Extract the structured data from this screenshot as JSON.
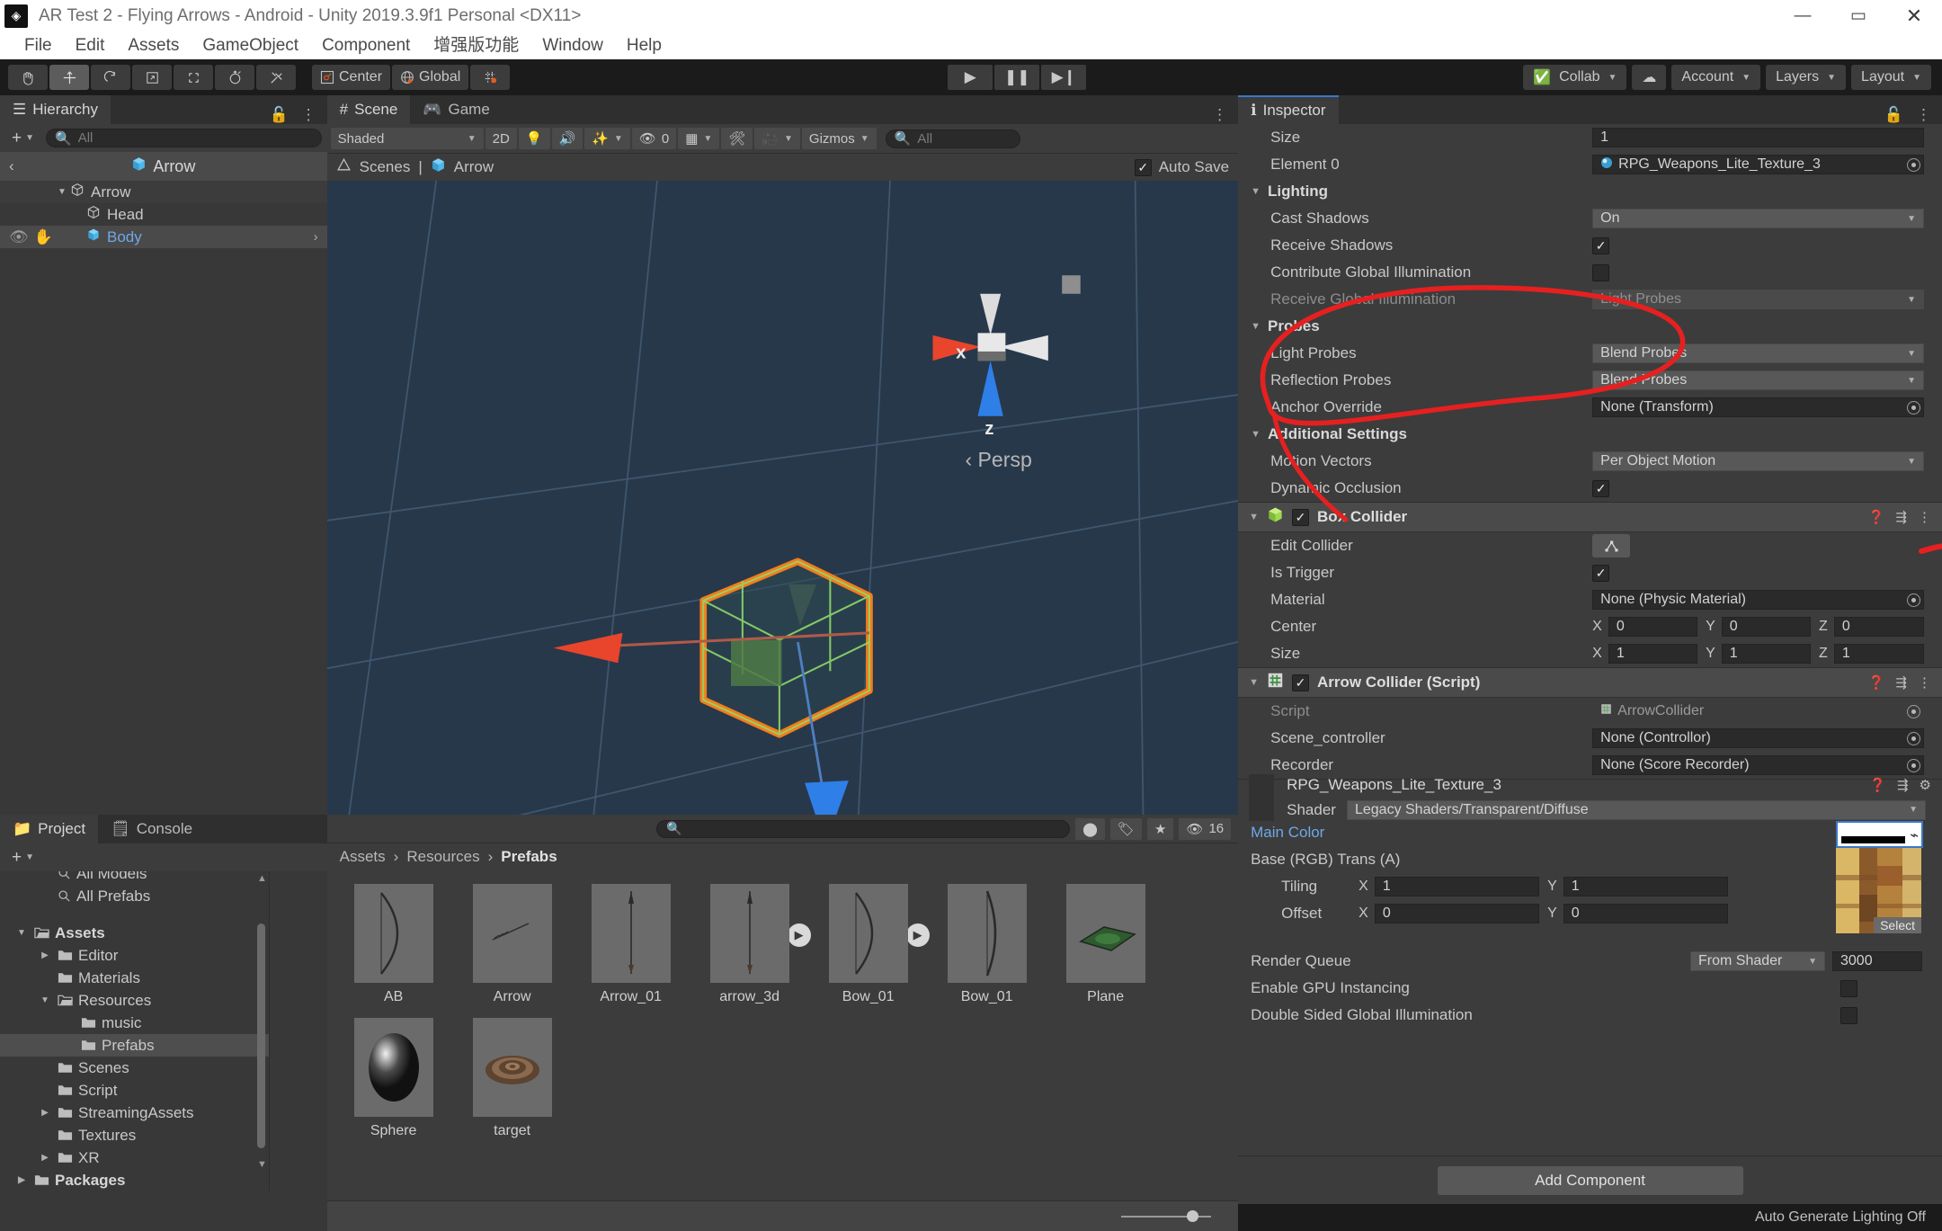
{
  "window": {
    "title": "AR Test 2 - Flying Arrows - Android - Unity 2019.3.9f1 Personal <DX11>",
    "minimize": "—",
    "maximize": "▭",
    "close": "✕"
  },
  "menubar": {
    "items": [
      "File",
      "Edit",
      "Assets",
      "GameObject",
      "Component",
      "增强版功能",
      "Window",
      "Help"
    ]
  },
  "toolbar": {
    "tools": [
      {
        "name": "hand-tool",
        "glyph": "✋"
      },
      {
        "name": "move-tool",
        "glyph": "✥"
      },
      {
        "name": "rotate-tool",
        "glyph": "⟳"
      },
      {
        "name": "scale-tool",
        "glyph": "⤢"
      },
      {
        "name": "rect-tool",
        "glyph": "▭"
      },
      {
        "name": "transform-tool",
        "glyph": "✣"
      },
      {
        "name": "custom-tool",
        "glyph": "✂"
      }
    ],
    "pivot_label": "Center",
    "space_label": "Global",
    "grid_label": "",
    "play": "▶",
    "pause": "❚❚",
    "step": "▶❙",
    "collab": "Collab",
    "cloud": "☁",
    "account": "Account",
    "layers": "Layers",
    "layout": "Layout"
  },
  "hierarchy": {
    "tab": "Hierarchy",
    "add_label": "+",
    "search_placeholder": "All",
    "breadcrumb": "Arrow",
    "back": "‹",
    "items": [
      {
        "label": "Arrow",
        "depth": 0,
        "expanded": true,
        "selected": false,
        "icon": "prefab-outline-icon"
      },
      {
        "label": "Head",
        "depth": 1,
        "expanded": false,
        "selected": false,
        "icon": "prefab-outline-icon"
      },
      {
        "label": "Body",
        "depth": 1,
        "expanded": false,
        "selected": true,
        "icon": "prefab-filled-icon"
      }
    ]
  },
  "scene": {
    "tabs": [
      {
        "label": "Scene",
        "icon": "scene-icon",
        "active": true
      },
      {
        "label": "Game",
        "icon": "game-icon",
        "active": false
      }
    ],
    "draw_mode": "Shaded",
    "mode_2d": "2D",
    "gizmos": "Gizmos",
    "gizmo_count": "0",
    "search_placeholder": "All",
    "breadcrumb_scene": "Scenes",
    "breadcrumb_prefab": "Arrow",
    "autosave_label": "Auto Save",
    "autosave_checked": true,
    "gizmo_axes": {
      "x": "x",
      "z": "z",
      "persp": "Persp"
    }
  },
  "inspector": {
    "tab": "Inspector",
    "materials_rows": [
      {
        "label": "Size",
        "value": "1",
        "type": "text"
      },
      {
        "label": "Element 0",
        "value": "RPG_Weapons_Lite_Texture_3",
        "type": "object"
      }
    ],
    "lighting": {
      "header": "Lighting",
      "rows": [
        {
          "label": "Cast Shadows",
          "value": "On",
          "type": "popup"
        },
        {
          "label": "Receive Shadows",
          "value": "",
          "type": "checkbox",
          "checked": true
        },
        {
          "label": "Contribute Global Illumination",
          "value": "",
          "type": "checkbox",
          "checked": false
        },
        {
          "label": "Receive Global Illumination",
          "value": "Light Probes",
          "type": "popup",
          "disabled": true
        }
      ]
    },
    "probes": {
      "header": "Probes",
      "rows": [
        {
          "label": "Light Probes",
          "value": "Blend Probes",
          "type": "popup"
        },
        {
          "label": "Reflection Probes",
          "value": "Blend Probes",
          "type": "popup"
        },
        {
          "label": "Anchor Override",
          "value": "None (Transform)",
          "type": "object"
        }
      ]
    },
    "additional": {
      "header": "Additional Settings",
      "rows": [
        {
          "label": "Motion Vectors",
          "value": "Per Object Motion",
          "type": "popup"
        },
        {
          "label": "Dynamic Occlusion",
          "value": "",
          "type": "checkbox",
          "checked": true
        }
      ]
    },
    "box_collider": {
      "title": "Box Collider",
      "enabled": true,
      "rows": [
        {
          "label": "Edit Collider",
          "type": "editbtn"
        },
        {
          "label": "Is Trigger",
          "type": "checkbox",
          "checked": true
        },
        {
          "label": "Material",
          "value": "None (Physic Material)",
          "type": "object"
        }
      ],
      "center": {
        "label": "Center",
        "x": "0",
        "y": "0",
        "z": "0"
      },
      "size": {
        "label": "Size",
        "x": "1",
        "y": "1",
        "z": "1"
      }
    },
    "arrow_collider": {
      "title": "Arrow Collider (Script)",
      "enabled": true,
      "rows": [
        {
          "label": "Script",
          "value": "ArrowCollider",
          "type": "script",
          "disabled": true
        },
        {
          "label": "Scene_controller",
          "value": "None (Controllor)",
          "type": "object"
        },
        {
          "label": "Recorder",
          "value": "None (Score Recorder)",
          "type": "object"
        }
      ]
    },
    "material": {
      "name": "RPG_Weapons_Lite_Texture_3",
      "shader_label": "Shader",
      "shader_value": "Legacy Shaders/Transparent/Diffuse",
      "main_color_label": "Main Color",
      "base_label": "Base (RGB) Trans (A)",
      "tiling": {
        "label": "Tiling",
        "x": "1",
        "y": "1"
      },
      "offset": {
        "label": "Offset",
        "x": "0",
        "y": "0"
      },
      "select_label": "Select",
      "render_queue_label": "Render Queue",
      "render_queue_mode": "From Shader",
      "render_queue_value": "3000",
      "gpu_instancing_label": "Enable GPU Instancing",
      "gpu_instancing_checked": false,
      "double_sided_label": "Double Sided Global Illumination",
      "double_sided_checked": false
    },
    "add_component": "Add Component"
  },
  "project": {
    "tabs": [
      {
        "label": "Project",
        "icon": "folder-icon",
        "active": true
      },
      {
        "label": "Console",
        "icon": "console-icon",
        "active": false
      }
    ],
    "add_label": "+",
    "search_placeholder": "",
    "asset_count": "16",
    "breadcrumb": [
      "Assets",
      "Resources",
      "Prefabs"
    ],
    "tree": [
      {
        "label": "All Models",
        "depth": 1,
        "icon": "search-icon",
        "tri": "",
        "clipped": true
      },
      {
        "label": "All Prefabs",
        "depth": 1,
        "icon": "search-icon",
        "tri": ""
      },
      {
        "label": "",
        "depth": 0,
        "icon": "",
        "tri": "",
        "spacer": true
      },
      {
        "label": "Assets",
        "depth": 0,
        "icon": "folder-open-icon",
        "tri": "▼",
        "bold": true
      },
      {
        "label": "Editor",
        "depth": 1,
        "icon": "folder-icon",
        "tri": "▶"
      },
      {
        "label": "Materials",
        "depth": 1,
        "icon": "folder-icon",
        "tri": ""
      },
      {
        "label": "Resources",
        "depth": 1,
        "icon": "folder-open-icon",
        "tri": "▼"
      },
      {
        "label": "music",
        "depth": 2,
        "icon": "folder-icon",
        "tri": ""
      },
      {
        "label": "Prefabs",
        "depth": 2,
        "icon": "folder-icon",
        "tri": "",
        "selected": true
      },
      {
        "label": "Scenes",
        "depth": 1,
        "icon": "folder-icon",
        "tri": ""
      },
      {
        "label": "Script",
        "depth": 1,
        "icon": "folder-icon",
        "tri": ""
      },
      {
        "label": "StreamingAssets",
        "depth": 1,
        "icon": "folder-icon",
        "tri": "▶"
      },
      {
        "label": "Textures",
        "depth": 1,
        "icon": "folder-icon",
        "tri": ""
      },
      {
        "label": "XR",
        "depth": 1,
        "icon": "folder-icon",
        "tri": "▶"
      },
      {
        "label": "Packages",
        "depth": 0,
        "icon": "folder-icon",
        "tri": "▶",
        "bold": true
      }
    ],
    "assets": [
      {
        "label": "AB",
        "thumb": "bow"
      },
      {
        "label": "Arrow",
        "thumb": "arrow-small"
      },
      {
        "label": "Arrow_01",
        "thumb": "arrow"
      },
      {
        "label": "arrow_3d",
        "thumb": "arrow",
        "play": true
      },
      {
        "label": "Bow_01",
        "thumb": "bow",
        "play": true
      },
      {
        "label": "Bow_01",
        "thumb": "bow2"
      },
      {
        "label": "Plane",
        "thumb": "plane"
      },
      {
        "label": "Sphere",
        "thumb": "sphere"
      },
      {
        "label": "target",
        "thumb": "target"
      }
    ]
  },
  "status": {
    "text": "Auto Generate Lighting Off"
  },
  "colors": {
    "accent_blue": "#3a78c8",
    "selection_orange": "#ff7f18",
    "axis_x": "#e8452c",
    "axis_z": "#2f7fe8",
    "scene_bg": "#27384b",
    "annotation_red": "#e62020",
    "link_blue": "#6ea8e8"
  }
}
